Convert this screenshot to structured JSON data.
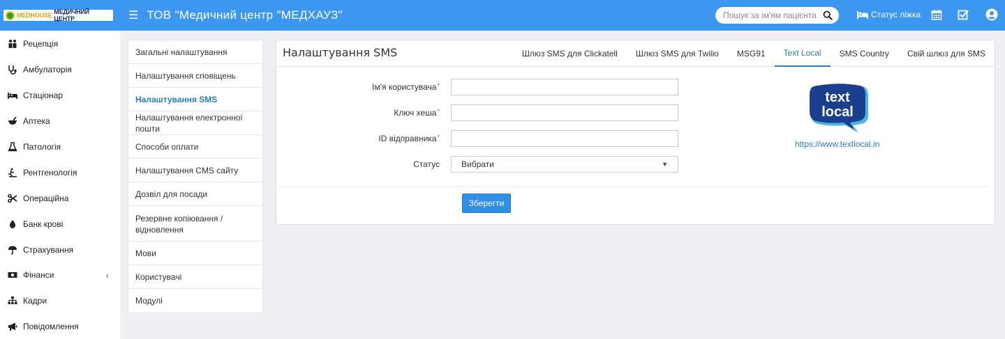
{
  "topbar": {
    "logo_brand": "MEDHOUSE",
    "logo_subtitle": "МЕДИЧНИЙ ЦЕНТР",
    "hospital_title": "ТОВ \"Медичний центр \"МЕДХАУЗ\"",
    "search_placeholder": "Пошук за ім'ям пацієнта",
    "bed_status_label": "Статус ліжка"
  },
  "sidebar": {
    "items": [
      {
        "label": "Рецепція",
        "icon": "reception-icon"
      },
      {
        "label": "Амбулаторія",
        "icon": "stethoscope-icon"
      },
      {
        "label": "Стаціонар",
        "icon": "bed-icon"
      },
      {
        "label": "Аптека",
        "icon": "mortar-icon"
      },
      {
        "label": "Патологія",
        "icon": "flask-icon"
      },
      {
        "label": "Рентгенологія",
        "icon": "xray-icon"
      },
      {
        "label": "Операційна",
        "icon": "scissors-icon"
      },
      {
        "label": "Банк крові",
        "icon": "blood-drop-icon"
      },
      {
        "label": "Страхування",
        "icon": "umbrella-icon"
      },
      {
        "label": "Фінанси",
        "icon": "money-icon"
      },
      {
        "label": "Кадри",
        "icon": "sitemap-icon"
      },
      {
        "label": "Повідомлення",
        "icon": "bullhorn-icon"
      }
    ]
  },
  "settings_menu": {
    "items": [
      "Загальні налаштування",
      "Налаштування сповіщень",
      "Налаштування SMS",
      "Налаштування електронної пошти",
      "Способи оплати",
      "Налаштування CMS сайту",
      "Дозвіл для посади",
      "Резервне копіювання / відновлення",
      "Мови",
      "Користувачі",
      "Модулі"
    ],
    "active_index": 2
  },
  "panel": {
    "title": "Налаштування SMS",
    "tabs": [
      "Шлюз SMS для Clickatell",
      "Шлюз SMS для Twilio",
      "MSG91",
      "Text Local",
      "SMS Country",
      "Свій шлюз для SMS"
    ],
    "active_tab": 3,
    "form": {
      "username_label": "Ім'я користувача",
      "username_value": "",
      "hash_label": "Ключ хеша",
      "hash_value": "",
      "sender_label": "ID відправника",
      "sender_value": "",
      "status_label": "Статус",
      "status_value": "Вибрати",
      "required_mark": "*",
      "save_label": "Зберегти"
    },
    "provider": {
      "logo_line1": "text",
      "logo_line2": "local",
      "url": "https://www.textlocal.in"
    }
  },
  "colors": {
    "topbar": "#3c97f0",
    "accent": "#2b7bbf",
    "button": "#2f8fe6",
    "required": "#e23c3c",
    "logo_navy": "#1b3f8f",
    "logo_light": "#4fb3e6"
  }
}
